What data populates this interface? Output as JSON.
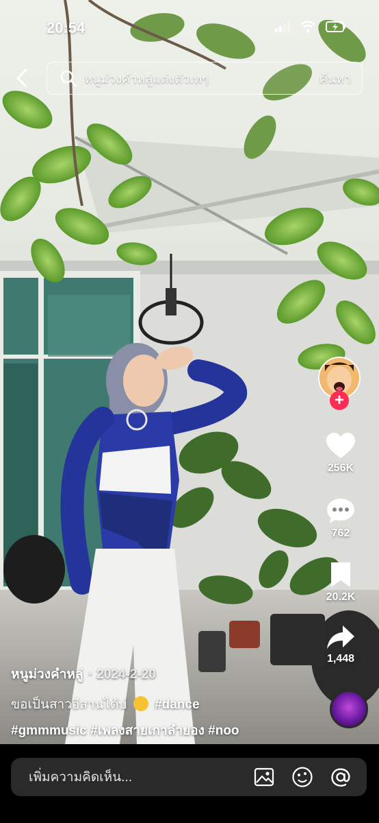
{
  "status_bar": {
    "time": "20:54",
    "icons": [
      "signal-icon",
      "wifi-icon",
      "battery-charging-icon"
    ]
  },
  "search": {
    "query": "หนูม่วงคำหลู่แต่งตัวเทๆ",
    "submit_label": "ค้นหา"
  },
  "actions": {
    "likes": "256K",
    "comments": "762",
    "saves": "20.2K",
    "shares": "1,448"
  },
  "caption": {
    "author": "หนูม่วงคำหลู่",
    "date": "· 2024-2-20",
    "line1_text": "ขอเป็นสาวอีสานได้บ่",
    "line1_tag": "#dance",
    "tag1": "#gmmmusic",
    "tag2": "#เพลงสายเกาลำยอง",
    "tag3": "#noo"
  },
  "comment_bar": {
    "placeholder": "เพิ่มความคิดเห็น..."
  },
  "colors": {
    "follow": "#fe2c55",
    "background": "#000000",
    "comment_box": "#2a2a2a"
  }
}
